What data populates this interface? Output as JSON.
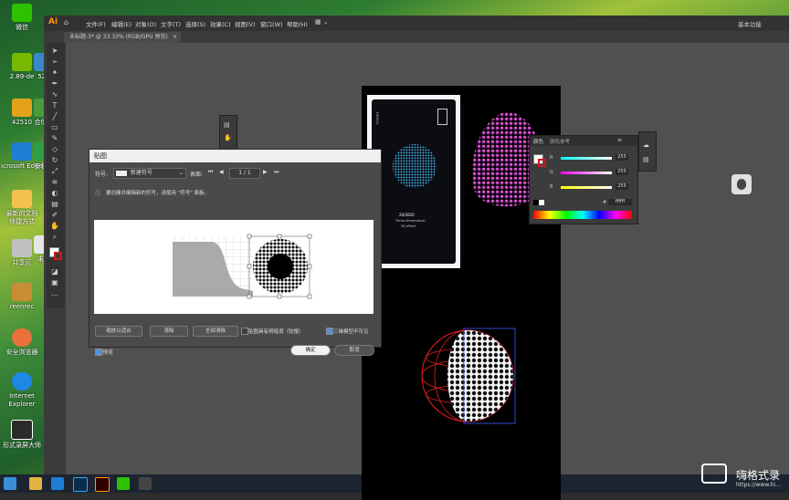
{
  "desktop": {
    "icons": [
      {
        "label": "微信"
      },
      {
        "label": "2.89-de"
      },
      {
        "label": "52h"
      },
      {
        "label": "42510"
      },
      {
        "label": "合信新"
      },
      {
        "label": "icrosoft Edge"
      },
      {
        "label": "安装包"
      },
      {
        "label": "最新的文档"
      },
      {
        "label": "快捷方式"
      },
      {
        "label": "未标"
      },
      {
        "label": "共享区"
      },
      {
        "label": "reenrec"
      },
      {
        "label": "安全浏览器"
      },
      {
        "label": "Internet Explorer"
      },
      {
        "label": "形式录屏大师"
      }
    ]
  },
  "illustrator": {
    "logo": "Ai",
    "menus": [
      "文件(F)",
      "编辑(E)",
      "对象(O)",
      "文字(T)",
      "选择(S)",
      "效果(C)",
      "视图(V)",
      "窗口(W)",
      "帮助(H)"
    ],
    "workspace_label": "基本功能",
    "doc_tab": "未标题-3* @ 33.33% (RGB/GPU 预览)",
    "doc_tab_close": "×"
  },
  "card": {
    "line1": "DESIGN",
    "line2": "20/2020",
    "line3": "Three-dimensional",
    "line4": "3D effect"
  },
  "color_panel": {
    "tab1": "颜色",
    "tab2": "颜色参考",
    "rows": [
      {
        "label": "R",
        "value": "255"
      },
      {
        "label": "G",
        "value": "255"
      },
      {
        "label": "B",
        "value": "255"
      }
    ],
    "hex_prefix": "#",
    "hex": "ffffff"
  },
  "dialog": {
    "title": "贴图",
    "symbol_label": "符号:",
    "symbol_value": "新建符号",
    "surface_label": "表面:",
    "surface_value": "1 / 1",
    "info_text": "要创建并编辑新的符号，请使用 \"符号\" 面板。",
    "buttons": {
      "scale_to_fit": "缩放以适合",
      "clear": "清除",
      "clear_all": "全部清除",
      "ok": "确定",
      "cancel": "取消"
    },
    "checkbox_shading": "贴图具有明暗调（较慢）",
    "checkbox_invisible": "三维模型不可见",
    "preview_label": "预览"
  },
  "watermark": "嗨格式录",
  "watermark_url": "https://www.hi..."
}
